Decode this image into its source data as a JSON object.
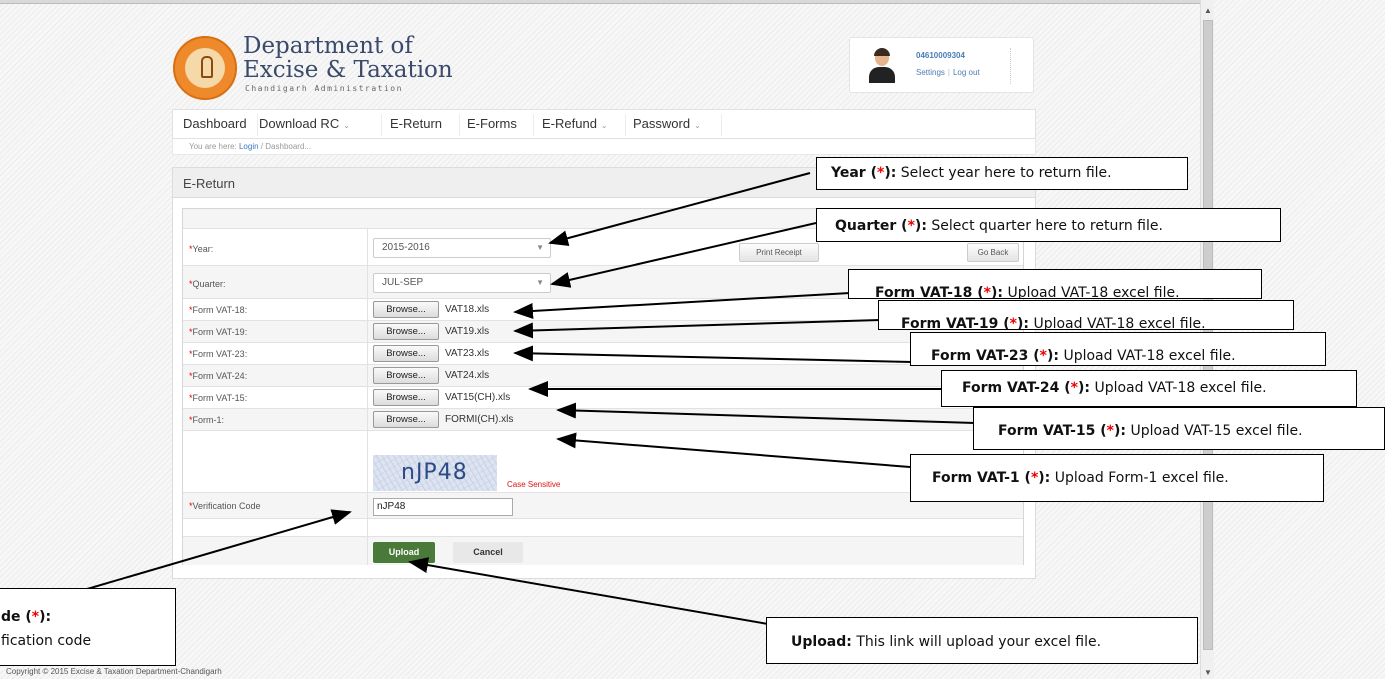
{
  "header": {
    "dept_title_line1": "Department of",
    "dept_title_line2": "Excise & Taxation",
    "dept_subtitle": "Chandigarh Administration"
  },
  "user": {
    "id": "04610009304",
    "settings_label": "Settings",
    "separator": "|",
    "logout_label": "Log out"
  },
  "nav": {
    "items": [
      "Dashboard",
      "Download RC",
      "E-Return",
      "E-Forms",
      "E-Refund",
      "Password"
    ]
  },
  "breadcrumb": {
    "prefix": "You are here:",
    "link": "Login",
    "sep": "/",
    "current": "Dashboard..."
  },
  "panel": {
    "title": "E-Return"
  },
  "form": {
    "year_label": "Year:",
    "year_value": "2015-2016",
    "quarter_label": "Quarter:",
    "quarter_value": "JUL-SEP",
    "print_label": "Print Receipt",
    "goback_label": "Go Back",
    "required_mark": "*",
    "browse_label": "Browse...",
    "files": [
      {
        "label": "Form VAT-18:",
        "file": "VAT18.xls"
      },
      {
        "label": "Form VAT-19:",
        "file": "VAT19.xls"
      },
      {
        "label": "Form VAT-23:",
        "file": "VAT23.xls"
      },
      {
        "label": "Form VAT-24:",
        "file": "VAT24.xls"
      },
      {
        "label": "Form VAT-15:",
        "file": "VAT15(CH).xls"
      },
      {
        "label": "Form-1:",
        "file": "FORMI(CH).xls"
      }
    ],
    "captcha_text": "nJP48",
    "case_sensitive": "Case Sensitive",
    "verification_label": "Verification Code",
    "verification_value": "nJP48",
    "upload_label": "Upload",
    "cancel_label": "Cancel"
  },
  "footer": {
    "copyright": "Copyright © 2015 Excise & Taxation Department-Chandigarh"
  },
  "callouts": {
    "year": {
      "title": "Year (",
      "star": "*",
      "close": "):",
      "text": " Select year here to return file."
    },
    "quarter": {
      "title": "Quarter (",
      "star": "*",
      "close": "):",
      "text": " Select quarter here to return file."
    },
    "vat18": {
      "title": "Form VAT-18 (",
      "star": "*",
      "close": "):",
      "text": " Upload VAT-18 excel file."
    },
    "vat19": {
      "title": "Form VAT-19 (",
      "star": "*",
      "close": "):",
      "text": " Upload VAT-18 excel file."
    },
    "vat23": {
      "title": "Form VAT-23 (",
      "star": "*",
      "close": "):",
      "text": " Upload VAT-18 excel file."
    },
    "vat24": {
      "title": "Form VAT-24 (",
      "star": "*",
      "close": "):",
      "text": " Upload VAT-18 excel file."
    },
    "vat15": {
      "title": "Form VAT-15 (",
      "star": "*",
      "close": "):",
      "text": " Upload VAT-15 excel file."
    },
    "vat1": {
      "title": "Form VAT-1 (",
      "star": "*",
      "close": "):",
      "text": " Upload Form-1 excel file."
    },
    "verif": {
      "title": "de (",
      "star": "*",
      "close": "):",
      "text": "fication code"
    },
    "upload": {
      "title": "Upload:",
      "text": " This link will upload your excel file."
    }
  }
}
